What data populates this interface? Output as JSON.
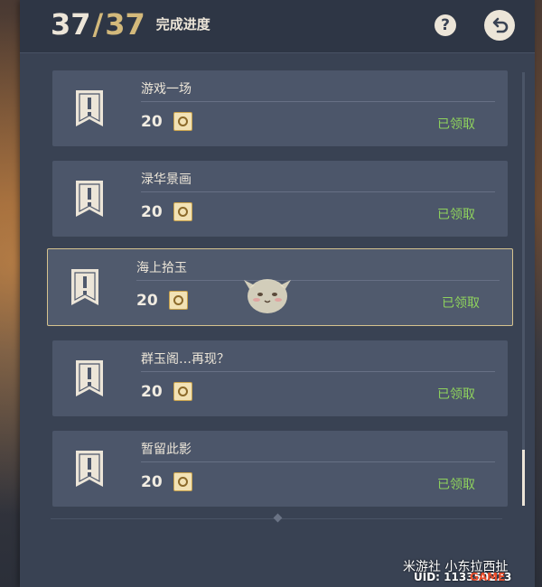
{
  "header": {
    "current": "37",
    "separator": "/",
    "total": "37",
    "label": "完成进度",
    "help_glyph": "?"
  },
  "icons": {
    "help": "question-mark-icon",
    "back": "back-arrow-icon",
    "achievement": "exclamation-banner-icon",
    "reward": "primogem-icon"
  },
  "achievements": [
    {
      "title": "游戏一场",
      "reward": "20",
      "status": "已领取"
    },
    {
      "title": "渌华景画",
      "reward": "20",
      "status": "已领取"
    },
    {
      "title": "海上拾玉",
      "reward": "20",
      "status": "已领取"
    },
    {
      "title": "群玉阁…再现？",
      "reward": "20",
      "status": "已领取"
    },
    {
      "title": "暂留此影",
      "reward": "20",
      "status": "已领取"
    }
  ],
  "selected_index": 2,
  "watermark": {
    "line1": "米游社 小东拉西扯",
    "line2": "UID: 113350223",
    "brand": "GAME"
  },
  "colors": {
    "gold": "#d3b97b",
    "claimed_green": "#8fd35d",
    "text_light": "#ece5d8"
  }
}
